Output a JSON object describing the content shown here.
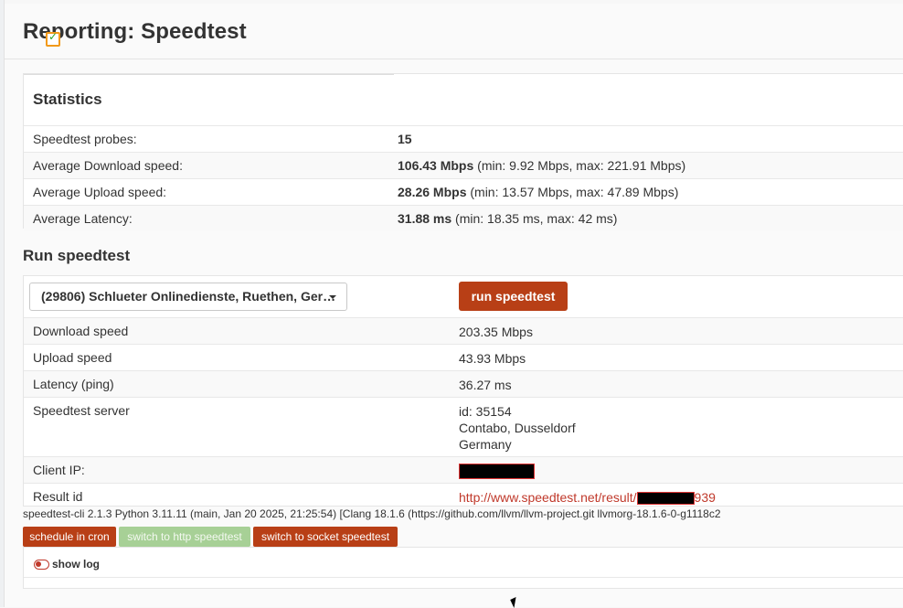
{
  "page": {
    "title": "Reporting: Speedtest"
  },
  "statistics": {
    "title": "Statistics",
    "rows": [
      {
        "label": "Speedtest probes:",
        "value_bold": "15",
        "value_rest": ""
      },
      {
        "label": "Average Download speed:",
        "value_bold": "106.43 Mbps",
        "value_rest": " (min: 9.92 Mbps, max: 221.91 Mbps)"
      },
      {
        "label": "Average Upload speed:",
        "value_bold": "28.26 Mbps",
        "value_rest": " (min: 13.57 Mbps, max: 47.89 Mbps)"
      },
      {
        "label": "Average Latency:",
        "value_bold": "31.88 ms",
        "value_rest": " (min: 18.35 ms, max: 42 ms)"
      }
    ]
  },
  "run": {
    "title": "Run speedtest",
    "server_select": "(29806) Schlueter Onlinedienste, Ruethen, Ger…",
    "run_button": "run speedtest",
    "download": {
      "label": "Download speed",
      "value": "203.35 Mbps"
    },
    "upload": {
      "label": "Upload speed",
      "value": "43.93 Mbps"
    },
    "latency": {
      "label": "Latency (ping)",
      "value": "36.27 ms"
    },
    "server": {
      "label": "Speedtest server",
      "line1": "id: 35154",
      "line2": "Contabo, Dusseldorf",
      "line3": "Germany"
    },
    "client_ip": {
      "label": "Client IP:"
    },
    "result": {
      "label": "Result id",
      "link_prefix": "http://www.speedtest.net/result/",
      "link_suffix": "939"
    }
  },
  "cli_info": "speedtest-cli 2.1.3 Python 3.11.11 (main, Jan 20 2025, 21:25:54) [Clang 18.1.6 (https://github.com/llvm/llvm-project.git llvmorg-18.1.6-0-g1118c2",
  "actions": {
    "cron": "schedule in cron",
    "http": "switch to http speedtest",
    "socket": "switch to socket speedtest"
  },
  "log": {
    "label": "show log"
  },
  "colors": {
    "accent": "#b83f16",
    "accent_light": "#a7d096",
    "link": "#c0392b"
  },
  "icons": {
    "title_overlay": "calendar-check-icon",
    "toggle": "toggle-off-icon"
  }
}
